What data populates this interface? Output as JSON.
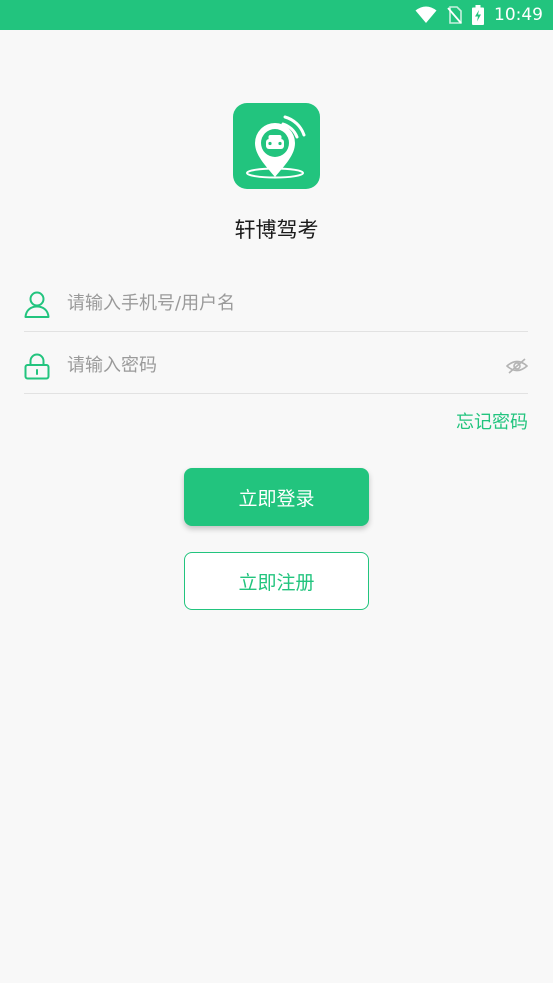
{
  "status_bar": {
    "time": "10:49",
    "icons": [
      "wifi-icon",
      "no-sim-icon",
      "battery-charging-icon"
    ]
  },
  "app": {
    "name": "轩博驾考",
    "logo_icon": "driving-location-pin-icon"
  },
  "form": {
    "username": {
      "placeholder": "请输入手机号/用户名",
      "value": "",
      "icon": "user-icon"
    },
    "password": {
      "placeholder": "请输入密码",
      "value": "",
      "icon": "lock-icon",
      "toggle_icon": "eye-hidden-icon"
    },
    "forgot_label": "忘记密码"
  },
  "buttons": {
    "login_label": "立即登录",
    "register_label": "立即注册"
  },
  "colors": {
    "accent": "#22c47e",
    "background": "#f8f8f8",
    "placeholder": "#9a9a9a"
  }
}
